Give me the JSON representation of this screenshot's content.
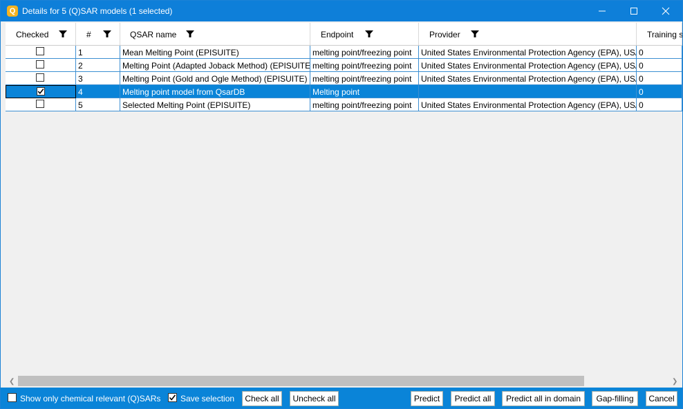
{
  "window": {
    "title": "Details for 5 (Q)SAR models (1 selected)",
    "icon_letter": "Q"
  },
  "columns": [
    {
      "label": "Checked"
    },
    {
      "label": "#"
    },
    {
      "label": "QSAR name"
    },
    {
      "label": "Endpoint"
    },
    {
      "label": "Provider"
    },
    {
      "label": "Training s"
    }
  ],
  "rows": [
    {
      "checked": false,
      "num": "1",
      "name": "Mean Melting Point (EPISUITE)",
      "endpoint": "melting point/freezing point",
      "provider": "United States Environmental Protection Agency (EPA), USA",
      "training": "0",
      "selected": false
    },
    {
      "checked": false,
      "num": "2",
      "name": "Melting Point (Adapted Joback Method) (EPISUITE)",
      "endpoint": "melting point/freezing point",
      "provider": "United States Environmental Protection Agency (EPA), USA",
      "training": "0",
      "selected": false
    },
    {
      "checked": false,
      "num": "3",
      "name": "Melting Point (Gold and Ogle Method) (EPISUITE)",
      "endpoint": "melting point/freezing point",
      "provider": "United States Environmental Protection Agency (EPA), USA",
      "training": "0",
      "selected": false
    },
    {
      "checked": true,
      "num": "4",
      "name": "Melting point model from QsarDB",
      "endpoint": "Melting point",
      "provider": "",
      "training": "0",
      "selected": true
    },
    {
      "checked": false,
      "num": "5",
      "name": "Selected Melting Point (EPISUITE)",
      "endpoint": "melting point/freezing point",
      "provider": "United States Environmental Protection Agency (EPA), USA",
      "training": "0",
      "selected": false
    }
  ],
  "bottom": {
    "show_relevant_label": "Show only chemical relevant (Q)SARs",
    "show_relevant_checked": false,
    "save_selection_label": "Save selection",
    "save_selection_checked": true,
    "check_all": "Check all",
    "uncheck_all": "Uncheck all",
    "predict": "Predict",
    "predict_all": "Predict all",
    "predict_all_domain": "Predict all in domain",
    "gap_filling": "Gap-filling",
    "cancel": "Cancel"
  },
  "colors": {
    "titlebar": "#0e7fd9",
    "selection": "#0a84d8",
    "grid_line": "#3c8fd2"
  }
}
